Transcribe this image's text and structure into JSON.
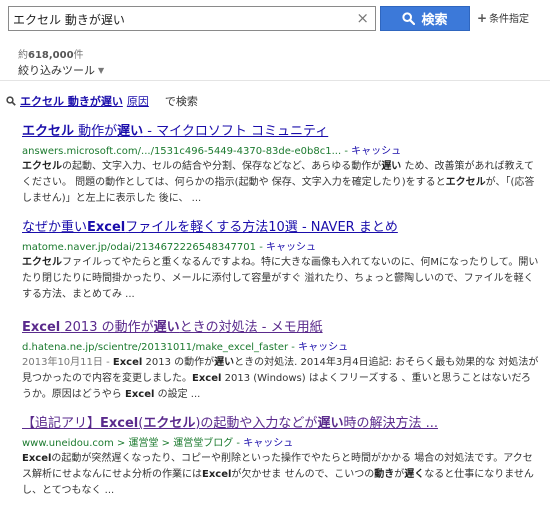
{
  "search": {
    "query": "エクセル 動きが遅い",
    "clear_icon": "×",
    "button_label": "検索",
    "advanced_label": "条件指定"
  },
  "stats": {
    "prefix": "約",
    "count": "618,000",
    "suffix": "件"
  },
  "filter_tools": {
    "label": "絞り込みツール"
  },
  "alt_search": {
    "query": "エクセル 動きが遅い",
    "original_label": "原因",
    "suffix": "で検索"
  },
  "results": [
    {
      "title_html": "<b>エクセル</b> 動作が<b>遅い</b> - マイクロソフト コミュニティ",
      "url": "answers.microsoft.com/.../1531c496-5449-4370-83de-e0b8c1... -",
      "cache": "キャッシュ",
      "visited": false,
      "snippet_html": "<b>エクセル</b>の起動、文字入力、セルの結合や分割、保存などなど、あらゆる動作が<b>遅い</b> ため、改善策があれば教えてください。 問題の動作としては、何らかの指示(起動や 保存、文字入力を確定したり)をすると<b>エクセル</b>が、「(応答しません)」と左上に表示した 後に、 ..."
    },
    {
      "title_html": "なぜか重い<b>Excel</b>ファイルを軽くする方法10選 - NAVER まとめ",
      "url": "matome.naver.jp/odai/2134672226548347701 -",
      "cache": "キャッシュ",
      "visited": false,
      "snippet_html": "<b>エクセル</b>ファイルってやたらと重くなるんですよね。特に大きな画像も入れてないのに、何Mになったりして。開いたり閉じたりに時間掛かったり、メールに添付して容量がすぐ 溢れたり、ちょっと鬱陶しいので、ファイルを軽くする方法、まとめてみ ..."
    },
    {
      "title_html": "<b>Excel</b> 2013 の動作が<b>遅い</b>ときの対処法 - メモ用紙",
      "url": "d.hatena.ne.jp/scientre/20131011/make_excel_faster -",
      "cache": "キャッシュ",
      "visited": true,
      "snippet_html": "<span class=\"date\">2013年10月11日 - </span><b>Excel</b> 2013 の動作が<b>遅い</b>ときの対処法. 2014年3月4日追記: おそらく最も効果的な 対処法が見つかったので内容を変更しました。<b>Excel</b> 2013 (Windows) はよくフリーズする 、重いと思うことはないだろうか。原因はどうやら <b>Excel</b> の設定 ..."
    },
    {
      "title_html": "【追記アリ】<b>Excel</b>(<b>エクセル</b>)の起動や入力などが<b>遅い</b>時の解決方法 ...",
      "url": "www.uneidou.com > 運営堂 > 運営堂ブログ -",
      "cache": "キャッシュ",
      "visited": true,
      "snippet_html": "<b>Excel</b>の起動が突然遅くなったり、コピーや削除といった操作でやたらと時間がかかる 場合の対処法です。アクセス解析にせよなんにせよ分析の作業には<b>Excel</b>が欠かせま せんので、こいつの<b>動き</b>が<b>遅く</b>なると仕事になりませんし、とてつもなく ..."
    }
  ]
}
